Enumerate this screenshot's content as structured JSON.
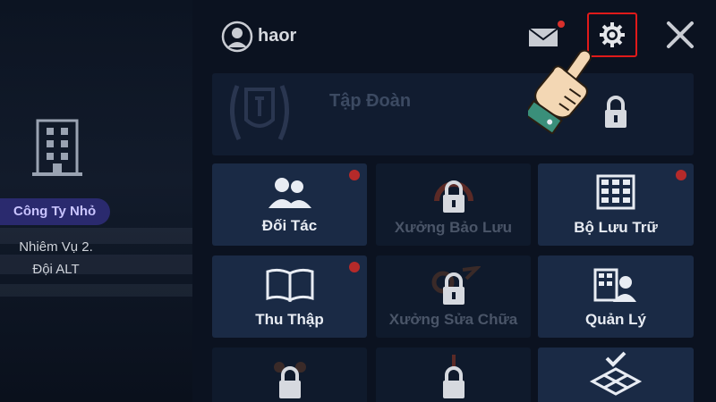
{
  "left": {
    "company_badge": "Công Ty Nhỏ",
    "mission_line1": "Nhiêm Vụ 2.",
    "mission_line2": "Đội ALT"
  },
  "header": {
    "username": "haor",
    "mail_has_notification": true
  },
  "group": {
    "label": "Tập Đoàn",
    "locked": true
  },
  "tiles": [
    {
      "label": "Đối Tác",
      "locked": false,
      "notify": true,
      "icon": "partners-icon"
    },
    {
      "label": "Xưởng Bảo Lưu",
      "locked": true,
      "notify": false,
      "icon": "lock-icon"
    },
    {
      "label": "Bộ Lưu Trữ",
      "locked": false,
      "notify": true,
      "icon": "storage-icon"
    },
    {
      "label": "Thu Thập",
      "locked": false,
      "notify": true,
      "icon": "book-icon"
    },
    {
      "label": "Xưởng Sửa Chữa",
      "locked": true,
      "notify": false,
      "icon": "lock-icon"
    },
    {
      "label": "Quản Lý",
      "locked": false,
      "notify": false,
      "icon": "manager-icon"
    },
    {
      "label": "",
      "locked": true,
      "notify": false,
      "icon": "lock-icon"
    },
    {
      "label": "",
      "locked": true,
      "notify": false,
      "icon": "lock-icon"
    },
    {
      "label": "",
      "locked": false,
      "notify": false,
      "icon": "tiles-check-icon"
    }
  ],
  "colors": {
    "accent_red": "#e01a1a",
    "tile_bg": "#1a2a45",
    "badge_bg": "#2a2a6e"
  }
}
